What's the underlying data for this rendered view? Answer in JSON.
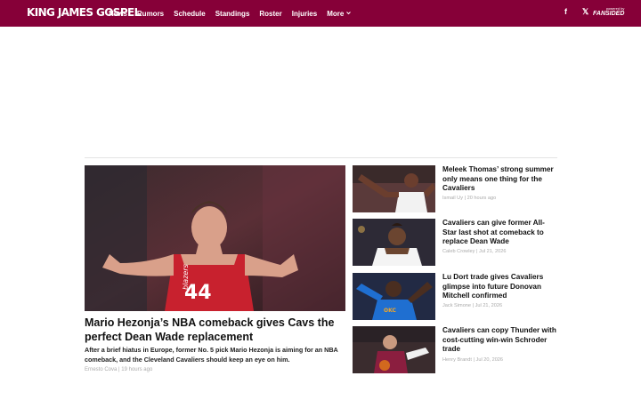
{
  "header": {
    "logo": "KING JAMES GOSPEL",
    "nav": [
      "News",
      "Rumors",
      "Schedule",
      "Standings",
      "Roster",
      "Injuries"
    ],
    "more_label": "More",
    "facebook": "f",
    "x": "𝕏",
    "powered_by": "powered by",
    "network": "FANSIDED"
  },
  "feature": {
    "title": "Mario Hezonja’s NBA comeback gives Cavs the perfect Dean Wade replacement",
    "description": "After a brief hiatus in Europe, former No. 5 pick Mario Hezonja is aiming for an NBA comeback, and the Cleveland Cavaliers should keep an eye on him.",
    "author": "Ernesto Cova",
    "time": "19 hours ago",
    "jersey_word": "blazers",
    "jersey_number": "44"
  },
  "side_articles": [
    {
      "title": "Meleek Thomas’ strong summer only means one thing for the Cavaliers",
      "author": "Ismail Uy",
      "time": "20 hours ago"
    },
    {
      "title": "Cavaliers can give former All-Star last shot at comeback to replace Dean Wade",
      "author": "Caleb Crowley",
      "time": "Jul 21, 2026"
    },
    {
      "title": "Lu Dort trade gives Cavaliers glimpse into future Donovan Mitchell confirmed",
      "author": "Jack Simone",
      "time": "Jul 21, 2026"
    },
    {
      "title": "Cavaliers can copy Thunder with cost-cutting win-win Schroder trade",
      "author": "Henry Brandt",
      "time": "Jul 20, 2026"
    }
  ],
  "meta_separator": "|",
  "colors": {
    "brand": "#860038",
    "meta": "#aaaaaa",
    "title": "#111111"
  }
}
